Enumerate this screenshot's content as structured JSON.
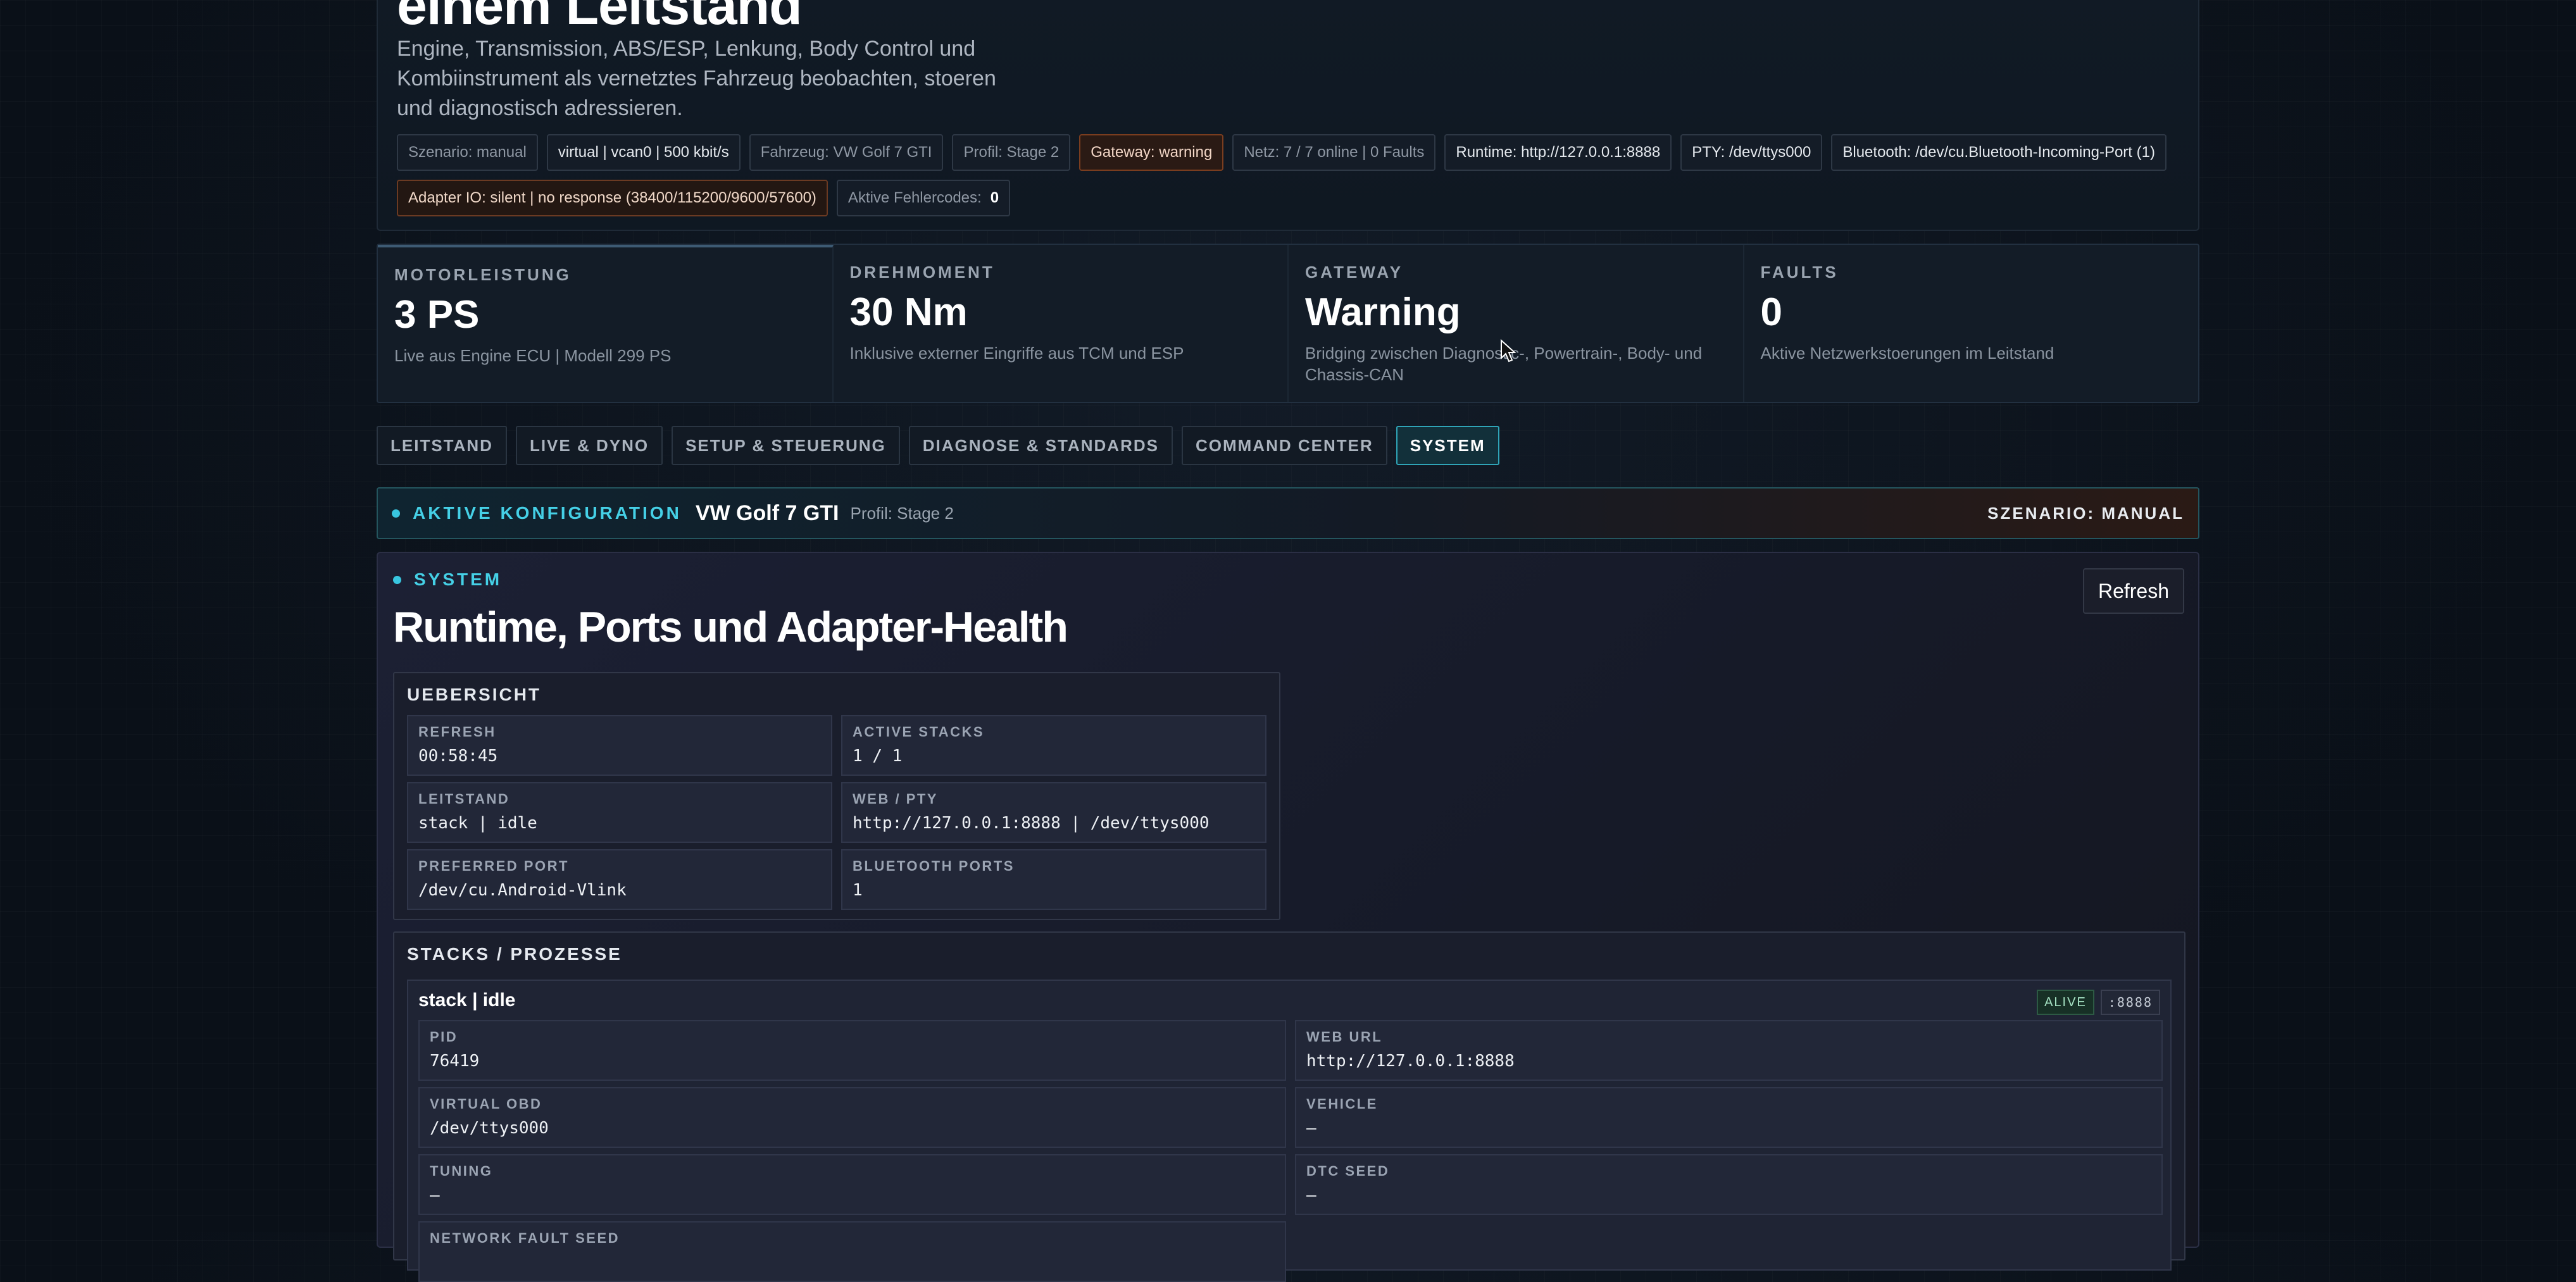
{
  "hero": {
    "title": "einem Leitstand",
    "subtitle": "Engine, Transmission, ABS/ESP, Lenkung, Body Control und Kombiinstrument als vernetztes Fahrzeug beobachten, stoeren und diagnostisch adressieren.",
    "chips": {
      "scenario": "Szenario: manual",
      "bus": "virtual | vcan0 | 500 kbit/s",
      "vehicle": "Fahrzeug: VW Golf 7 GTI",
      "profile": "Profil: Stage 2",
      "gateway": "Gateway: warning",
      "network": "Netz: 7 / 7 online | 0 Faults",
      "runtime": "Runtime: http://127.0.0.1:8888",
      "pty": "PTY: /dev/ttys000",
      "bluetooth": "Bluetooth: /dev/cu.Bluetooth-Incoming-Port (1)",
      "adapter": "Adapter IO: silent | no response (38400/115200/9600/57600)",
      "dtc_label": "Aktive Fehlercodes:",
      "dtc_value": "0"
    }
  },
  "metrics": [
    {
      "label": "MOTORLEISTUNG",
      "value": "3 PS",
      "desc": "Live aus Engine ECU | Modell 299 PS"
    },
    {
      "label": "DREHMOMENT",
      "value": "30 Nm",
      "desc": "Inklusive externer Eingriffe aus TCM und ESP"
    },
    {
      "label": "GATEWAY",
      "value": "Warning",
      "desc": "Bridging zwischen Diagnostic-, Powertrain-, Body- und Chassis-CAN"
    },
    {
      "label": "FAULTS",
      "value": "0",
      "desc": "Aktive Netzwerkstoerungen im Leitstand"
    }
  ],
  "tabs": [
    "LEITSTAND",
    "LIVE & DYNO",
    "SETUP & STEUERUNG",
    "DIAGNOSE & STANDARDS",
    "COMMAND CENTER",
    "SYSTEM"
  ],
  "config": {
    "label": "AKTIVE KONFIGURATION",
    "vehicle": "VW Golf 7 GTI",
    "profile": "Profil: Stage 2",
    "scenario": "SZENARIO: MANUAL"
  },
  "system": {
    "eyebrow": "SYSTEM",
    "title": "Runtime, Ports und Adapter-Health",
    "refresh_label": "Refresh",
    "overview": {
      "title": "UEBERSICHT",
      "cells": [
        {
          "label": "REFRESH",
          "value": "00:58:45"
        },
        {
          "label": "ACTIVE STACKS",
          "value": "1 / 1"
        },
        {
          "label": "LEITSTAND",
          "value": "stack | idle"
        },
        {
          "label": "WEB / PTY",
          "value": "http://127.0.0.1:8888 | /dev/ttys000"
        },
        {
          "label": "PREFERRED PORT",
          "value": "/dev/cu.Android-Vlink"
        },
        {
          "label": "BLUETOOTH PORTS",
          "value": "1"
        }
      ]
    },
    "stacks": {
      "title": "STACKS / PROZESSE",
      "card": {
        "name": "stack | idle",
        "status_badge": "ALIVE",
        "port_badge": ":8888",
        "cells": [
          {
            "label": "PID",
            "value": "76419"
          },
          {
            "label": "WEB URL",
            "value": "http://127.0.0.1:8888"
          },
          {
            "label": "VIRTUAL OBD",
            "value": "/dev/ttys000"
          },
          {
            "label": "VEHICLE",
            "value": "–"
          },
          {
            "label": "TUNING",
            "value": "–"
          },
          {
            "label": "DTC SEED",
            "value": "–"
          },
          {
            "label": "NETWORK FAULT SEED",
            "value": ""
          }
        ]
      }
    }
  },
  "colors": {
    "accent": "#45d0e6",
    "warning": "#7a3d1f",
    "alive": "#a6e3c4"
  }
}
